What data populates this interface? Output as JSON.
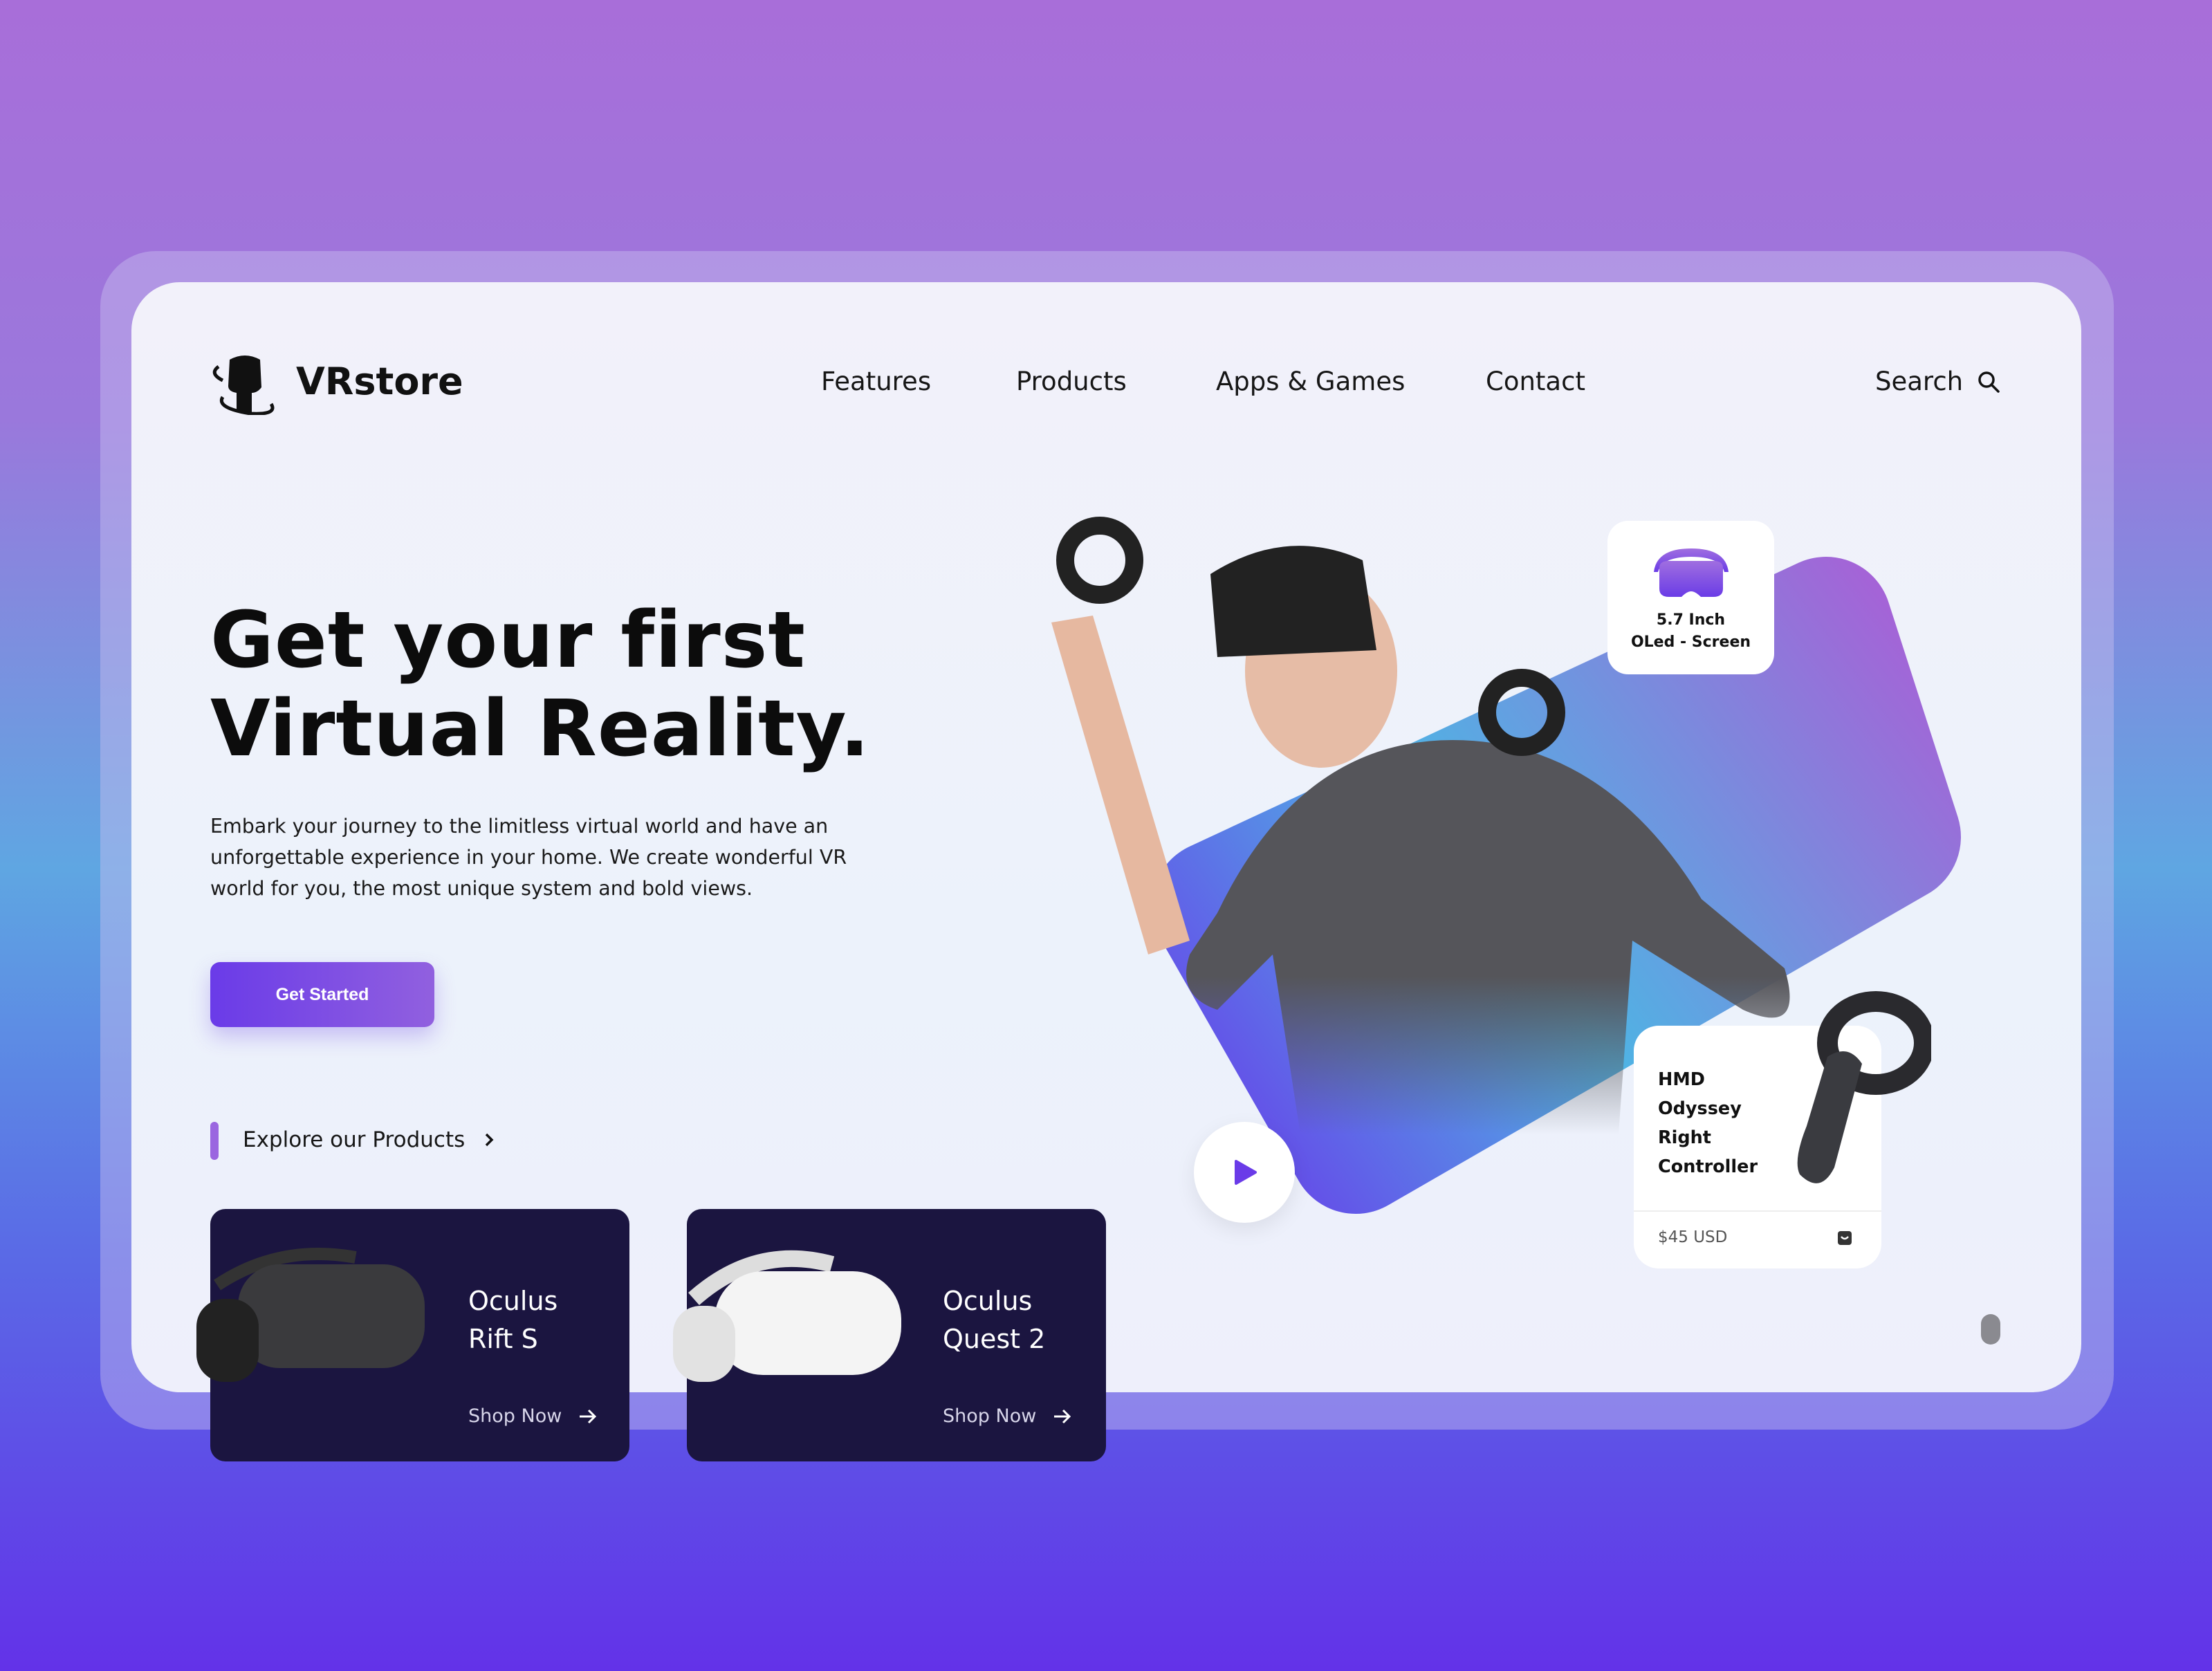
{
  "brand": {
    "name": "VRstore",
    "logo_icon": "vr-headset-head-icon"
  },
  "nav": {
    "items": [
      "Features",
      "Products",
      "Apps & Games",
      "Contact"
    ],
    "search_label": "Search",
    "search_icon": "search-icon"
  },
  "hero": {
    "heading_line1": "Get your first",
    "heading_line2": "Virtual Reality.",
    "paragraph_line1": "Embark your journey to the limitless virtual world and have an",
    "paragraph_line2": "unforgettable experience in your home. We  create wonderful VR",
    "paragraph_line3": "world for you, the most unique system and bold views.",
    "cta_label": "Get Started",
    "explore_label": "Explore our Products"
  },
  "products": [
    {
      "name_line1": "Oculus",
      "name_line2": "Rift S",
      "action": "Shop Now"
    },
    {
      "name_line1": "Oculus",
      "name_line2": "Quest 2",
      "action": "Shop Now"
    }
  ],
  "spec_card": {
    "line1": "5.7 Inch",
    "line2": "OLed - Screen",
    "icon": "vr-headset-icon"
  },
  "controller_card": {
    "lines": [
      "HMD",
      "Odyssey",
      "Right",
      "Controller"
    ],
    "price": "$45 USD",
    "icon": "shopping-bag-icon"
  },
  "colors": {
    "accent": "#6a3be8",
    "accent_light": "#9160df",
    "card_dark": "#1b1540",
    "blob_start": "#4fb8e4",
    "blob_end": "#a35fd8"
  }
}
